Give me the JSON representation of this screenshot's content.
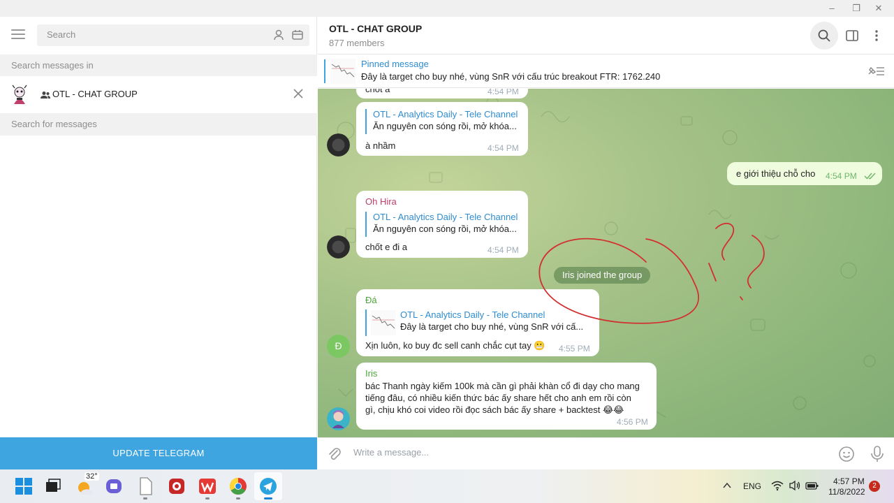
{
  "window": {
    "minimize": "–",
    "restore": "❐",
    "close": "✕"
  },
  "sidebar": {
    "search_placeholder": "Search",
    "search_in_label": "Search messages in",
    "chat_filter_name": "OTL - CHAT GROUP",
    "search_for_label": "Search for messages",
    "update_button": "UPDATE TELEGRAM"
  },
  "header": {
    "title": "OTL - CHAT GROUP",
    "members": "877 members"
  },
  "pinned": {
    "label": "Pinned message",
    "text": "Đây là target cho buy nhé, vùng SnR với cấu trúc breakout FTR: 1762.240"
  },
  "messages": [
    {
      "text": "chốt a",
      "time": "4:54 PM"
    },
    {
      "fwd_title": "OTL - Analytics Daily - Tele Channel",
      "fwd_text": "Ăn nguyên con sóng rồi, mở khóa...",
      "text": "à nhầm",
      "time": "4:54 PM"
    },
    {
      "text": "e giới thiệu chỗ cho",
      "time": "4:54 PM",
      "outgoing": true
    },
    {
      "sender": "Oh Hira",
      "sender_color": "#c03d6c",
      "fwd_title": "OTL - Analytics Daily - Tele Channel",
      "fwd_text": "Ăn nguyên con sóng rồi, mở khóa...",
      "text": "chốt e đi a",
      "time": "4:54 PM"
    },
    {
      "service": "Iris joined the group"
    },
    {
      "sender": "Đá",
      "sender_color": "#4aa738",
      "avatar_letter": "Đ",
      "fwd_title": "OTL - Analytics Daily - Tele Channel",
      "fwd_text": "Đây là target cho buy nhé, vùng SnR với cấ...",
      "text": "Xịn luôn, ko buy đc sell canh chắc cụt tay 😬",
      "time": "4:55 PM"
    },
    {
      "sender": "Iris",
      "sender_color": "#4aa738",
      "lines": [
        "bác Thanh ngày kiếm 100k mà cần gì phải khàn cổ đi dạy cho mang",
        "tiếng đâu, có nhiều kiến thức bác ấy share hết cho anh em rồi còn",
        "gì, chịu khó coi video rồi đọc sách bác ấy share + backtest 😂😂"
      ],
      "time": "4:56 PM"
    }
  ],
  "compose": {
    "placeholder": "Write a message..."
  },
  "taskbar": {
    "weather": "32°",
    "lang": "ENG",
    "time": "4:57 PM",
    "date": "11/8/2022",
    "notifications": "2"
  },
  "colors": {
    "accent": "#3fa5e0",
    "link": "#2e8ccf",
    "outgoing": "#effdde",
    "annotation": "#d32f2f"
  }
}
